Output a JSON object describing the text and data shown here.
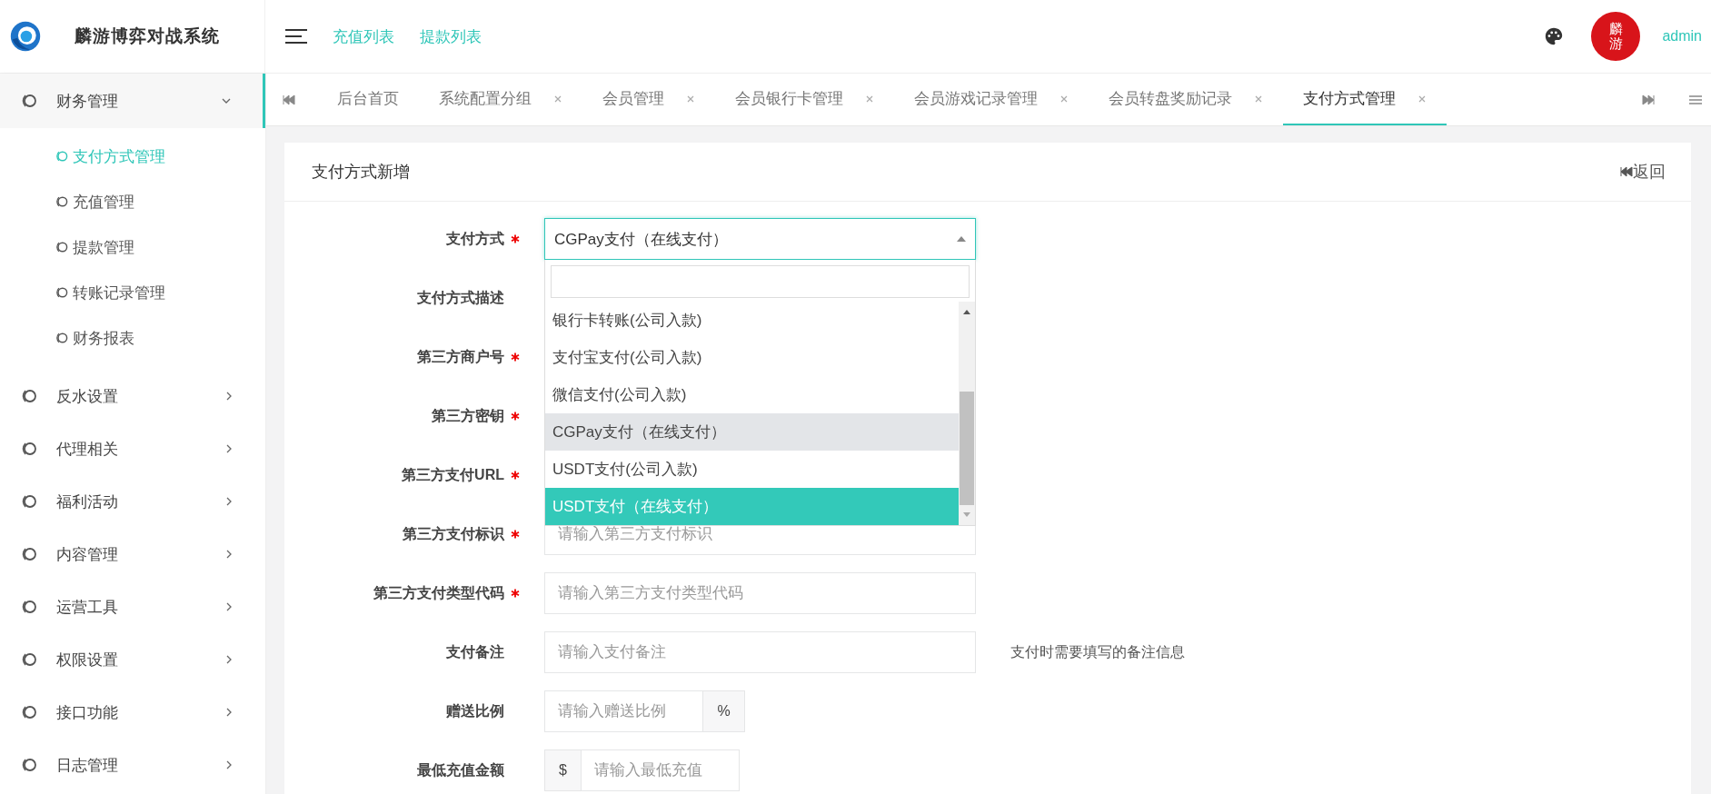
{
  "header": {
    "app_title": "麟游博弈对战系统",
    "links": [
      "充值列表",
      "提款列表"
    ],
    "avatar_text": "麟游",
    "username": "admin"
  },
  "sidebar": {
    "items": [
      {
        "label": "财务管理",
        "expanded": true,
        "children": [
          {
            "label": "支付方式管理",
            "selected": true
          },
          {
            "label": "充值管理",
            "selected": false
          },
          {
            "label": "提款管理",
            "selected": false
          },
          {
            "label": "转账记录管理",
            "selected": false
          },
          {
            "label": "财务报表",
            "selected": false
          }
        ]
      },
      {
        "label": "反水设置",
        "expanded": false
      },
      {
        "label": "代理相关",
        "expanded": false
      },
      {
        "label": "福利活动",
        "expanded": false
      },
      {
        "label": "内容管理",
        "expanded": false
      },
      {
        "label": "运营工具",
        "expanded": false
      },
      {
        "label": "权限设置",
        "expanded": false
      },
      {
        "label": "接口功能",
        "expanded": false
      },
      {
        "label": "日志管理",
        "expanded": false
      }
    ]
  },
  "tabs": [
    {
      "label": "后台首页",
      "closable": false,
      "selected": false
    },
    {
      "label": "系统配置分组",
      "closable": true,
      "selected": false
    },
    {
      "label": "会员管理",
      "closable": true,
      "selected": false
    },
    {
      "label": "会员银行卡管理",
      "closable": true,
      "selected": false
    },
    {
      "label": "会员游戏记录管理",
      "closable": true,
      "selected": false
    },
    {
      "label": "会员转盘奖励记录",
      "closable": true,
      "selected": false
    },
    {
      "label": "支付方式管理",
      "closable": true,
      "selected": true
    }
  ],
  "card": {
    "title": "支付方式新增",
    "back_label": "返回"
  },
  "form": {
    "fields": [
      {
        "kind": "select",
        "label": "支付方式",
        "required": true,
        "value": "CGPay支付（在线支付）",
        "expanded": true,
        "options": [
          {
            "label": "银行卡转账(公司入款)",
            "selected": false,
            "highlighted": false
          },
          {
            "label": "支付宝支付(公司入款)",
            "selected": false,
            "highlighted": false
          },
          {
            "label": "微信支付(公司入款)",
            "selected": false,
            "highlighted": false
          },
          {
            "label": "CGPay支付（在线支付）",
            "selected": true,
            "highlighted": false
          },
          {
            "label": "USDT支付(公司入款)",
            "selected": false,
            "highlighted": false
          },
          {
            "label": "USDT支付（在线支付）",
            "selected": false,
            "highlighted": true
          }
        ]
      },
      {
        "kind": "text",
        "label": "支付方式描述",
        "required": false
      },
      {
        "kind": "text",
        "label": "第三方商户号",
        "required": true
      },
      {
        "kind": "text",
        "label": "第三方密钥",
        "required": true
      },
      {
        "kind": "text",
        "label": "第三方支付URL",
        "required": true
      },
      {
        "kind": "text",
        "label": "第三方支付标识",
        "required": true,
        "placeholder": "请输入第三方支付标识"
      },
      {
        "kind": "text",
        "label": "第三方支付类型代码",
        "required": true,
        "placeholder": "请输入第三方支付类型代码"
      },
      {
        "kind": "text",
        "label": "支付备注",
        "required": false,
        "placeholder": "请输入支付备注",
        "help": "支付时需要填写的备注信息"
      },
      {
        "kind": "addon_after",
        "label": "赠送比例",
        "required": false,
        "placeholder": "请输入赠送比例",
        "addon": "%"
      },
      {
        "kind": "addon_before",
        "label": "最低充值金额",
        "required": false,
        "placeholder": "请输入最低充值",
        "addon": "$"
      }
    ]
  }
}
